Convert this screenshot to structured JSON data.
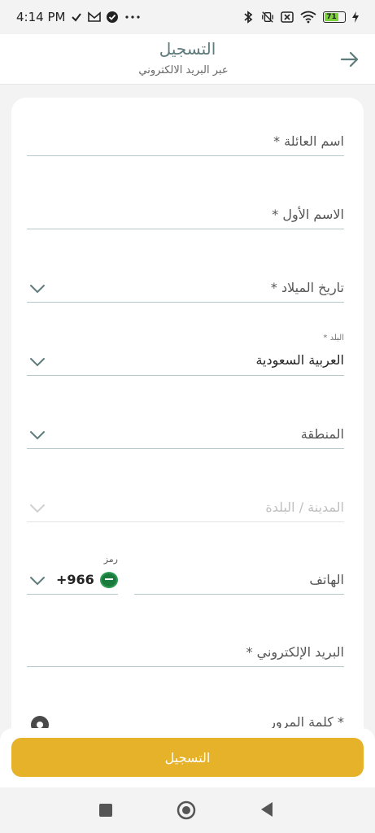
{
  "status_bar": {
    "time": "4:14 PM",
    "battery": "71",
    "icons": [
      "check-icon",
      "gmail-icon",
      "check-circle-icon",
      "more-icon",
      "bluetooth-icon",
      "vibrate-off-icon",
      "close-box-icon",
      "wifi-icon",
      "battery-icon",
      "charging-icon"
    ]
  },
  "header": {
    "title": "التسجيل",
    "subtitle": "عبر البريد الالكتروني"
  },
  "form": {
    "family_name_label": "اسم العائلة *",
    "first_name_label": "الاسم الأول *",
    "birth_date_label": "تاريخ الميلاد *",
    "country_small_label": "البلد *",
    "country_value": "العربية السعودية",
    "region_label": "المنطقة",
    "city_label": "المدينة / البلدة",
    "phone_code_label": "رمز",
    "phone_code_value": "+966",
    "phone_label": "الهاتف",
    "email_label": "البريد الإلكتروني *",
    "password_label": "* كلمة المرور"
  },
  "actions": {
    "register_label": "التسجيل"
  },
  "colors": {
    "accent": "#e5b22a",
    "title": "#5f7b7c",
    "underline": "#b5c8ca"
  }
}
